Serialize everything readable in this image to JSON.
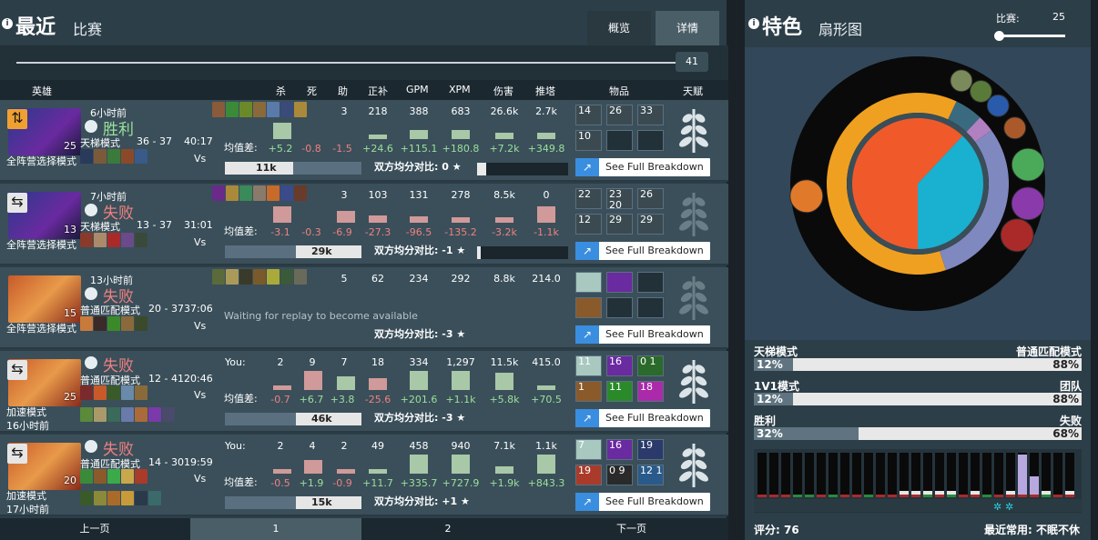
{
  "header": {
    "title": "最近",
    "subtitle": "比赛",
    "info_glyph": "i",
    "tabs": [
      "概览",
      "详情"
    ]
  },
  "matches_slider": {
    "value": "41"
  },
  "columns": {
    "hero": "英雄",
    "kills": "杀",
    "deaths": "死",
    "assists": "助",
    "last_hits": "正补",
    "gpm": "GPM",
    "xpm": "XPM",
    "damage": "伤害",
    "towers": "推塔",
    "items": "物品",
    "talents": "天赋"
  },
  "avg_label": "均值差:",
  "compare_label": "双方均分对比:",
  "see_full": "See Full Breakdown",
  "matches": [
    {
      "time": "6小时前",
      "result": "胜利",
      "outcome": "win",
      "mode": "全阵营选择模式",
      "lobby": "天梯模式",
      "score": "36 - 37",
      "duration": "40:17",
      "level": "25",
      "kills": "",
      "deaths": "",
      "assists": "3",
      "last_hits": "218",
      "gpm": "388",
      "xpm": "683",
      "damage": "26.6k",
      "towers": "2.7k",
      "d_kills": "+5.2",
      "d_deaths": "-0.8",
      "d_assists": "-1.5",
      "d_lh": "+24.6",
      "d_gpm": "+115.1",
      "d_xpm": "+180.8",
      "d_dmg": "+7.2k",
      "d_tow": "+349.8",
      "gold": "11k",
      "cmp_value": "0",
      "items": [
        "14",
        "26",
        "33",
        "10",
        "",
        ""
      ]
    },
    {
      "time": "7小时前",
      "result": "失败",
      "outcome": "lose",
      "mode": "全阵营选择模式",
      "lobby": "天梯模式",
      "score": "13 - 37",
      "duration": "31:01",
      "level": "13",
      "kills": "",
      "deaths": "",
      "assists": "3",
      "last_hits": "103",
      "gpm": "131",
      "xpm": "278",
      "damage": "8.5k",
      "towers": "0",
      "d_kills": "-3.1",
      "d_deaths": "-0.3",
      "d_assists": "-6.9",
      "d_lh": "-27.3",
      "d_gpm": "-96.5",
      "d_xpm": "-135.2",
      "d_dmg": "-3.2k",
      "d_tow": "-1.1k",
      "gold": "29k",
      "cmp_value": "-1",
      "items": [
        "22",
        "23\n20",
        "26",
        "12",
        "29",
        "29"
      ]
    },
    {
      "time": "13小时前",
      "result": "失败",
      "outcome": "lose",
      "mode": "全阵营选择模式",
      "lobby": "普通匹配模式",
      "score": "20 - 37",
      "duration": "37:06",
      "level": "15",
      "kills": "",
      "deaths": "",
      "assists": "5",
      "last_hits": "62",
      "gpm": "234",
      "xpm": "292",
      "damage": "8.8k",
      "towers": "214.0",
      "waiting": "Waiting for replay to become available",
      "cmp_value": "-3",
      "items": [
        "",
        "",
        "",
        "",
        "",
        ""
      ]
    },
    {
      "time": "16小时前",
      "result": "失败",
      "outcome": "lose",
      "mode": "加速模式",
      "lobby": "普通匹配模式",
      "score": "12 - 41",
      "duration": "20:46",
      "level": "25",
      "you": "You:",
      "kills": "2",
      "deaths": "9",
      "assists": "7",
      "last_hits": "18",
      "gpm": "334",
      "xpm": "1,297",
      "damage": "11.5k",
      "towers": "415.0",
      "d_kills": "-0.7",
      "d_deaths": "+6.7",
      "d_assists": "+3.8",
      "d_lh": "-25.6",
      "d_gpm": "+201.6",
      "d_xpm": "+1.1k",
      "d_dmg": "+5.8k",
      "d_tow": "+70.5",
      "gold": "46k",
      "cmp_value": "-3",
      "items": [
        "11",
        "16",
        "0\n1",
        "1",
        "11",
        "18"
      ]
    },
    {
      "time": "17小时前",
      "result": "失败",
      "outcome": "lose",
      "mode": "加速模式",
      "lobby": "普通匹配模式",
      "score": "14 - 30",
      "duration": "19:59",
      "level": "20",
      "you": "You:",
      "kills": "2",
      "deaths": "4",
      "assists": "2",
      "last_hits": "49",
      "gpm": "458",
      "xpm": "940",
      "damage": "7.1k",
      "towers": "1.1k",
      "d_kills": "-0.5",
      "d_deaths": "+1.9",
      "d_assists": "-0.9",
      "d_lh": "+11.7",
      "d_gpm": "+335.7",
      "d_xpm": "+727.9",
      "d_dmg": "+1.9k",
      "d_tow": "+843.3",
      "gold": "15k",
      "cmp_value": "+1",
      "items": [
        "7",
        "16",
        "19",
        "19",
        "0\n9",
        "12\n1"
      ]
    }
  ],
  "pager": {
    "prev": "上一页",
    "p1": "1",
    "p2": "2",
    "next": "下一页"
  },
  "side": {
    "title": "特色",
    "subtitle": "扇形图",
    "info_glyph": "i",
    "slider_label": "比赛:",
    "slider_value": "25",
    "bars": [
      {
        "left": "天梯模式",
        "right": "普通匹配模式",
        "lpct": "12%",
        "rpct": "88%",
        "frac": 0.12
      },
      {
        "left": "1V1模式",
        "right": "团队",
        "lpct": "12%",
        "rpct": "88%",
        "frac": 0.12
      },
      {
        "left": "胜利",
        "right": "失败",
        "lpct": "32%",
        "rpct": "68%",
        "frac": 0.32
      }
    ],
    "score_label": "评分:",
    "score": "76",
    "recent_label": "最近常用:",
    "recent": "不眠不休"
  },
  "colors": {
    "accent": "#3a8ee0",
    "win": "#9be09b",
    "lose": "#f08080",
    "pie_orange": "#f05a2a",
    "pie_cyan": "#1ab0d0",
    "pie_purple": "#8088c0",
    "pie_gold": "#f0a020"
  },
  "chart_data": {
    "type": "pie",
    "title": "扇形图",
    "series": [
      {
        "name": "inner",
        "values": [
          0.62,
          0.38
        ],
        "colors": [
          "#f05a2a",
          "#1ab0d0"
        ]
      },
      {
        "name": "middle",
        "values": [
          0.62,
          0.05,
          0.03,
          0.3
        ],
        "colors": [
          "#f0a020",
          "#3a6a80",
          "#b080c0",
          "#8088c0"
        ]
      }
    ]
  }
}
